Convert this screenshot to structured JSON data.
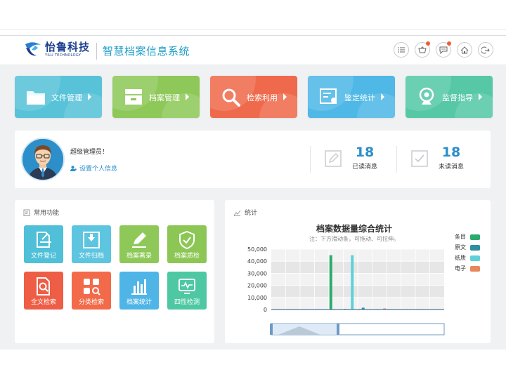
{
  "header": {
    "logo_name": "怡鲁科技",
    "logo_sub": "YILU TECHNOLOGY",
    "system_title": "智慧档案信息系统",
    "icons": [
      "list-icon",
      "basket-icon",
      "message-icon",
      "home-icon",
      "logout-icon"
    ]
  },
  "nav_tiles": [
    {
      "label": "文件管理",
      "color": "#58c3d8",
      "icon": "folder-icon"
    },
    {
      "label": "档案管理",
      "color": "#8ec858",
      "icon": "archive-box-icon"
    },
    {
      "label": "检索利用",
      "color": "#ef6a4c",
      "icon": "search-icon"
    },
    {
      "label": "鉴定统计",
      "color": "#4fb8e6",
      "icon": "certificate-icon"
    },
    {
      "label": "监督指导",
      "color": "#56c8a6",
      "icon": "camera-icon"
    }
  ],
  "user": {
    "greeting": "超级管理员！",
    "profile_link": "设置个人信息",
    "read_count": "18",
    "read_label": "已读消息",
    "unread_count": "18",
    "unread_label": "未读消息"
  },
  "common": {
    "title": "常用功能",
    "items": [
      {
        "label": "文件登记",
        "color": "#4fc0d8",
        "icon": "file-register-icon"
      },
      {
        "label": "文件归档",
        "color": "#5ec5e0",
        "icon": "file-archive-icon"
      },
      {
        "label": "档案著录",
        "color": "#8ec858",
        "icon": "archive-record-icon"
      },
      {
        "label": "档案质检",
        "color": "#8cc654",
        "icon": "quality-check-icon"
      },
      {
        "label": "全文检索",
        "color": "#ee5d45",
        "icon": "fulltext-search-icon"
      },
      {
        "label": "分类检索",
        "color": "#f26a4a",
        "icon": "category-search-icon"
      },
      {
        "label": "档案统计",
        "color": "#4fb4e6",
        "icon": "statistics-icon"
      },
      {
        "label": "四性检测",
        "color": "#4dc8a2",
        "icon": "monitor-check-icon"
      }
    ]
  },
  "stats_panel": {
    "title": "统计"
  },
  "chart_data": {
    "type": "bar",
    "title": "档案数据量综合统计",
    "subtitle": "注：下方滑动条，可拖动、可拉伸。",
    "y_ticks": [
      "50,000",
      "40,000",
      "30,000",
      "20,000",
      "10,000",
      "0"
    ],
    "ylim": [
      0,
      50000
    ],
    "grid": true,
    "legend_placement": "right",
    "series": [
      {
        "name": "条目",
        "color": "#2aab6c",
        "values": [
          200,
          300,
          300,
          300,
          45000,
          500,
          400,
          300,
          300,
          300,
          200,
          300
        ]
      },
      {
        "name": "原文",
        "color": "#2c8fa0",
        "values": [
          100,
          100,
          100,
          100,
          300,
          100,
          1500,
          100,
          100,
          100,
          100,
          100
        ]
      },
      {
        "name": "纸质",
        "color": "#5ed1d8",
        "values": [
          100,
          100,
          100,
          100,
          200,
          45000,
          400,
          100,
          100,
          100,
          100,
          100
        ]
      },
      {
        "name": "电子",
        "color": "#e8875e",
        "values": [
          50,
          50,
          50,
          50,
          100,
          100,
          50,
          900,
          50,
          50,
          50,
          50
        ]
      }
    ]
  }
}
